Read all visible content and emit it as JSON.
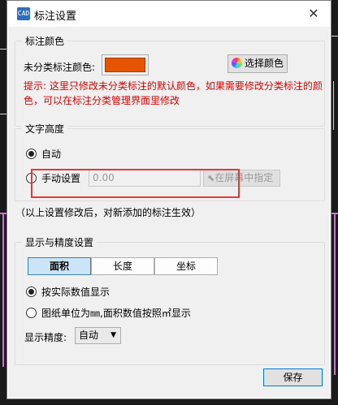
{
  "window": {
    "title": "标注设置",
    "icon_label": "CAD",
    "close_glyph": "✕"
  },
  "mark_color": {
    "group_title": "标注颜色",
    "unclassified_label": "未分类标注颜色:",
    "color": "#e55400",
    "choose_button": "选择颜色",
    "hint": "提示: 这里只修改未分类标注的默认颜色，如果需要修改分类标注的颜色，可以在标注分类管理界面里修改"
  },
  "text_height": {
    "group_title": "文字高度",
    "auto_label": "自动",
    "manual_label": "手动设置",
    "manual_value": "0.00",
    "pick_button": "在屏幕中指定",
    "selected": "auto"
  },
  "note": "（以上设置修改后，对新添加的标注生效）",
  "display": {
    "group_title": "显示与精度设置",
    "tabs": [
      "面积",
      "长度",
      "坐标"
    ],
    "active_tab": "面积",
    "option_actual": "按实际数值显示",
    "option_paper": "图纸单位为㎜,面积数值按照㎡显示",
    "selected": "actual",
    "precision_label": "显示精度:",
    "precision_value": "自动"
  },
  "ok_button": "保存"
}
